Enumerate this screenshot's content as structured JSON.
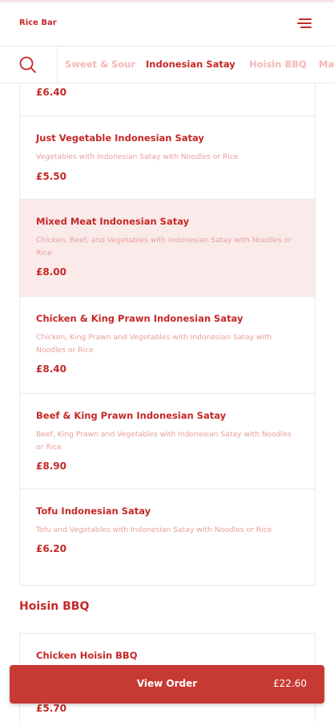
{
  "header": {
    "brand": "Rice Bar"
  },
  "categories": {
    "tabs": [
      {
        "label": "Sweet & Sour"
      },
      {
        "label": "Indonesian Satay",
        "active": true
      },
      {
        "label": "Hoisin BBQ"
      },
      {
        "label": "Ma"
      }
    ]
  },
  "satay_items": [
    {
      "price": "£6.40"
    },
    {
      "name": "Just Vegetable Indonesian Satay",
      "desc": "Vegetables with Indonesian Satay with Noodles or Rice",
      "price": "£5.50"
    },
    {
      "name": "Mixed Meat Indonesian Satay",
      "desc": "Chicken, Beef, and Vegetables with Indonesian Satay with Noodles or Rice",
      "price": "£8.00"
    },
    {
      "name": "Chicken & King Prawn Indonesian Satay",
      "desc": "Chicken, King Prawn and Vegetables with Indonesian Satay with Noodles or Rice",
      "price": "£8.40"
    },
    {
      "name": "Beef & King Prawn Indonesian Satay",
      "desc": "Beef, King Prawn and Vegetables with Indonesian Satay with Noodles or Rice",
      "price": "£8.90"
    },
    {
      "name": "Tofu Indonesian Satay",
      "desc": "Tofu and Vegetables with Indonesian Satay with Noodles or Rice",
      "price": "£6.20"
    }
  ],
  "hoisin_section": {
    "title": "Hoisin BBQ",
    "items": [
      {
        "name": "Chicken Hoisin BBQ",
        "price": "£5.70"
      }
    ]
  },
  "order_bar": {
    "label": "View Order",
    "total": "£22.60"
  },
  "colors": {
    "accent": "#c62828",
    "button": "#c73a33",
    "highlight": "#fbeaea",
    "muted": "#ea9d9d"
  }
}
